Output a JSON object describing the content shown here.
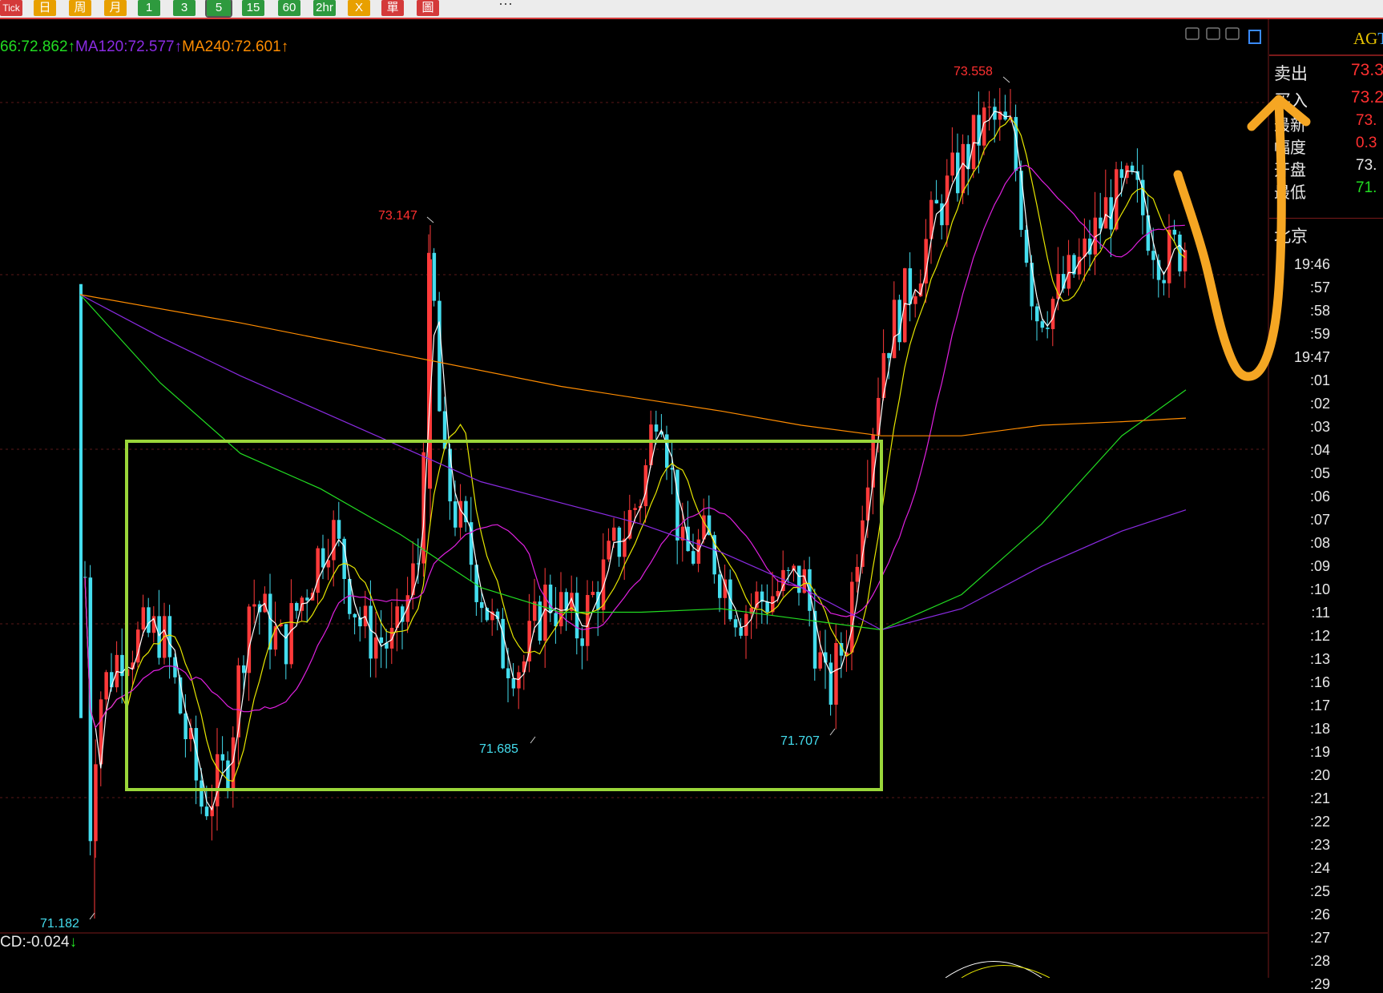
{
  "toolbar": {
    "buttons": [
      {
        "label": "Tick",
        "bg": "#d43a3a",
        "fg": "#ffffff"
      },
      {
        "label": "日",
        "bg": "#e8a000",
        "fg": "#ffffff"
      },
      {
        "label": "周",
        "bg": "#e8a000",
        "fg": "#ffffff"
      },
      {
        "label": "月",
        "bg": "#e8a000",
        "fg": "#ffffff"
      },
      {
        "label": "1",
        "bg": "#2e9a3e",
        "fg": "#ffffff"
      },
      {
        "label": "3",
        "bg": "#2e9a3e",
        "fg": "#ffffff"
      },
      {
        "label": "5",
        "bg": "#2e9a3e",
        "fg": "#ffffff",
        "active": true
      },
      {
        "label": "15",
        "bg": "#2e9a3e",
        "fg": "#ffffff"
      },
      {
        "label": "60",
        "bg": "#2e9a3e",
        "fg": "#ffffff"
      },
      {
        "label": "2hr",
        "bg": "#2e9a3e",
        "fg": "#ffffff"
      },
      {
        "label": "X",
        "bg": "#e8a000",
        "fg": "#ffffff"
      },
      {
        "label": "單",
        "bg": "#d43a3a",
        "fg": "#ffffff"
      },
      {
        "label": "圖",
        "bg": "#d43a3a",
        "fg": "#ffffff"
      }
    ],
    "more_label": "···"
  },
  "ma_legend": [
    {
      "text": "66:72.862↑",
      "color": "#22dd22"
    },
    {
      "text": "MA120:72.577↑",
      "color": "#8a2be2"
    },
    {
      "text": "MA240:72.601↑",
      "color": "#ff8c00"
    }
  ],
  "macd_legend": {
    "prefix": "CD:",
    "value": "-0.024",
    "arrow": "↓",
    "arrow_color": "#22dd22"
  },
  "panel": {
    "symbol_short": "AG",
    "symbol_tail": "T",
    "rows": [
      {
        "label": "卖出",
        "value": "73.3",
        "value_color": "#ff3030"
      },
      {
        "label": "买入",
        "value": "73.2",
        "value_color": "#ff3030"
      },
      {
        "label": "最新",
        "value": "73.",
        "value_color": "#ff3030"
      },
      {
        "label": "幅度",
        "value": "0.3",
        "value_color": "#ff3030"
      },
      {
        "label": "开盘",
        "value": "73.",
        "value_color": "#e8e8e8"
      },
      {
        "label": "最低",
        "value": "71.",
        "value_color": "#22dd22"
      }
    ],
    "timezone": "北京",
    "times": [
      "19:46",
      ":57",
      ":58",
      ":59",
      "19:47",
      ":01",
      ":02",
      ":03",
      ":04",
      ":05",
      ":06",
      ":07",
      ":08",
      ":09",
      ":10",
      ":11",
      ":12",
      ":13",
      ":16",
      ":17",
      ":18",
      ":19",
      ":20",
      ":21",
      ":22",
      ":23",
      ":24",
      ":25",
      ":26",
      ":27",
      ":28",
      ":29"
    ]
  },
  "chart_data": {
    "type": "candlestick",
    "title": "",
    "price_range": [
      70.9,
      73.7
    ],
    "annotations": [
      {
        "text": "73.558",
        "value": 73.558,
        "color": "#ff3030"
      },
      {
        "text": "73.147",
        "value": 73.147,
        "color": "#ff3030"
      },
      {
        "text": "71.685",
        "value": 71.685,
        "color": "#44ddee"
      },
      {
        "text": "71.707",
        "value": 71.707,
        "color": "#44ddee"
      },
      {
        "text": "71.182",
        "value": 71.182,
        "color": "#44ddee"
      }
    ],
    "highlight_box": {
      "color": "#9ad63a",
      "price_top": 72.35,
      "price_bottom": 71.45
    },
    "ma_colors": {
      "MA5": "#ffffff",
      "MA10": "#e6e600",
      "MA30": "#e020e0",
      "MA60": "#22dd22",
      "MA120": "#8a2be2",
      "MA240": "#ff8c00"
    },
    "hand_drawn_color": "#f5a623"
  }
}
